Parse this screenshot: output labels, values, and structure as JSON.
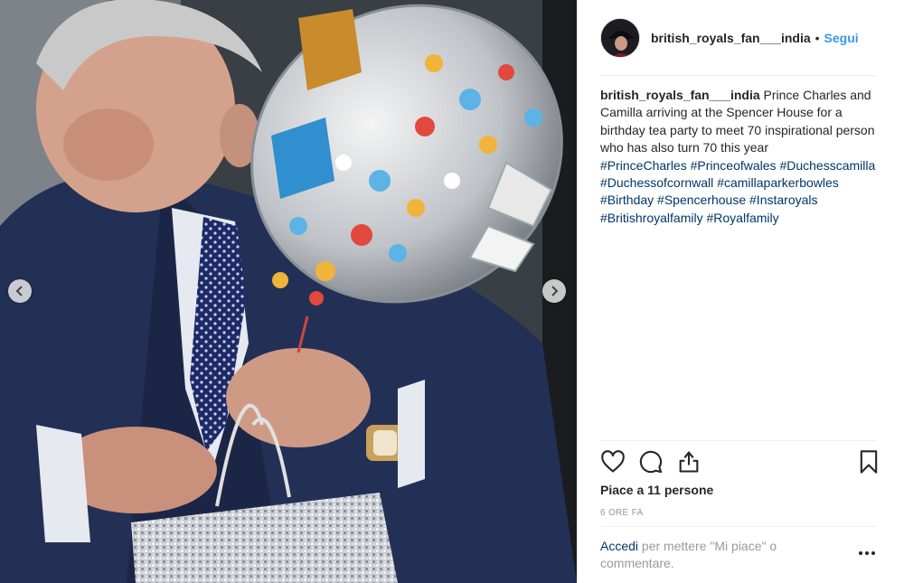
{
  "header": {
    "username": "british_royals_fan___india",
    "separator": "•",
    "follow_label": "Segui"
  },
  "caption": {
    "username": "british_royals_fan___india",
    "text": "Prince Charles and Camilla arriving at the Spencer House for a birthday tea party to meet 70 inspirational person who has also turn 70 this year",
    "hashtags": [
      "#PrinceCharles",
      "#Princeofwales",
      "#Duchesscamilla",
      "#Duchessofcornwall",
      "#camillaparkerbowles",
      "#Birthday",
      "#Spencerhouse",
      "#Instaroyals",
      "#Britishroyalfamily",
      "#Royalfamily"
    ]
  },
  "actions": {
    "like_icon": "heart-icon",
    "comment_icon": "comment-bubble-icon",
    "share_icon": "share-upload-icon",
    "save_icon": "bookmark-icon"
  },
  "likes_text": "Piace a 11 persone",
  "timestamp": "6 ORE FA",
  "comment_prompt": {
    "login_link": "Accedi",
    "rest": " per mettere \"Mi piace\" o commentare."
  },
  "more_options_icon": "more-options-icon",
  "carousel": {
    "prev_icon": "chevron-left-icon",
    "next_icon": "chevron-right-icon"
  },
  "colors": {
    "link_blue": "#3897f0",
    "hashtag_blue": "#003569",
    "text": "#262626",
    "muted": "#999999",
    "divider": "#efefef"
  }
}
